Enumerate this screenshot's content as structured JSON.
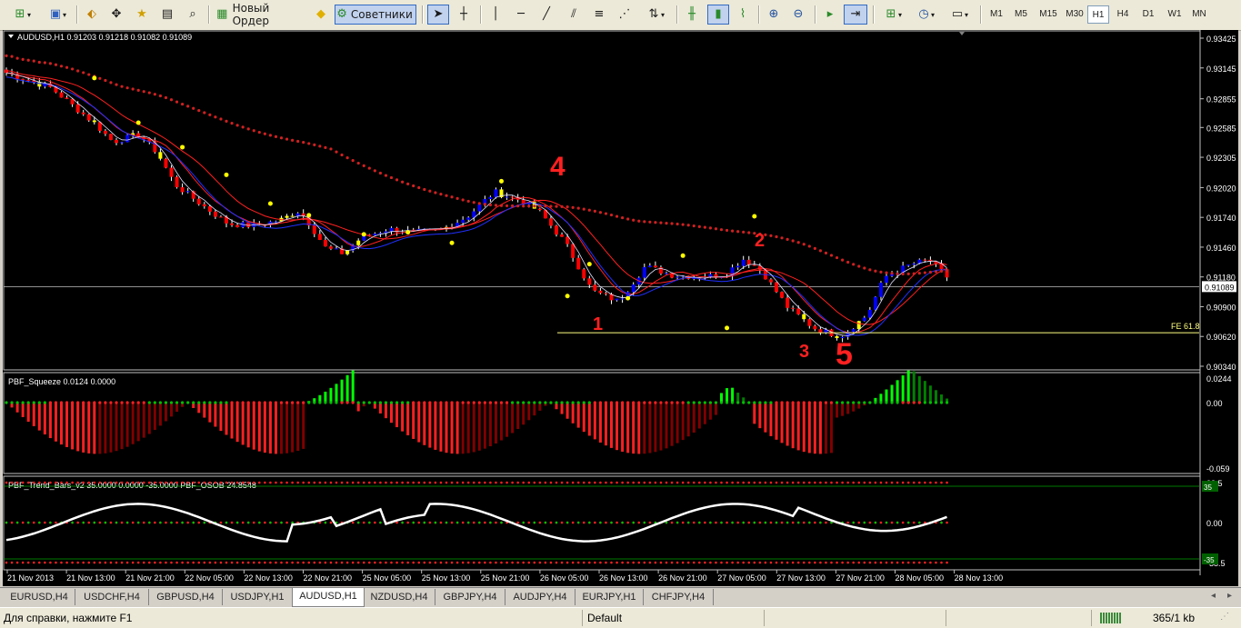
{
  "toolbar": {
    "new_order_label": "Новый Ордер",
    "advisors_label": "Советники",
    "timeframes": [
      "M1",
      "M5",
      "M15",
      "M30",
      "H1",
      "H4",
      "D1",
      "W1",
      "MN"
    ],
    "active_timeframe": "H1"
  },
  "chart": {
    "symbol_info": "AUDUSD,H1  0.91203 0.91218 0.91082 0.91089",
    "current_price": "0.91089",
    "fe_label": "FE 61.8",
    "price_ticks": [
      "0.93425",
      "0.93145",
      "0.92855",
      "0.92585",
      "0.92305",
      "0.92020",
      "0.91740",
      "0.91460",
      "0.91180",
      "0.90900",
      "0.90620",
      "0.90340"
    ],
    "annotations": [
      "4",
      "2",
      "1",
      "3",
      "5"
    ],
    "squeeze_label": "PBF_Squeeze 0.0124 0.0000",
    "squeeze_ticks": [
      "0.0244",
      "0.00",
      "-0.059"
    ],
    "trend_label": "PBF_Trend_Bars_v2 35.0000 0.0000 -35.0000  PBF_OSOB 24.8548",
    "trend_ticks": [
      "38.5",
      "0.00",
      "-38.5"
    ],
    "trend_level_high": "35",
    "trend_level_low": "-35",
    "time_labels": [
      "21 Nov 2013",
      "21 Nov 13:00",
      "21 Nov 21:00",
      "22 Nov 05:00",
      "22 Nov 13:00",
      "22 Nov 21:00",
      "25 Nov 05:00",
      "25 Nov 13:00",
      "25 Nov 21:00",
      "26 Nov 05:00",
      "26 Nov 13:00",
      "26 Nov 21:00",
      "27 Nov 05:00",
      "27 Nov 13:00",
      "27 Nov 21:00",
      "28 Nov 05:00",
      "28 Nov 13:00"
    ],
    "colors": {
      "bull": "#0000ff",
      "bear": "#ff0000",
      "doji": "#ffff00",
      "grid": "#c0c0c0",
      "green": "#00ff00"
    }
  },
  "tabs": [
    "EURUSD,H4",
    "USDCHF,H4",
    "GBPUSD,H4",
    "USDJPY,H1",
    "AUDUSD,H1",
    "NZDUSD,H4",
    "GBPJPY,H4",
    "AUDJPY,H4",
    "EURJPY,H1",
    "CHFJPY,H4"
  ],
  "active_tab": "AUDUSD,H1",
  "status": {
    "help": "Для справки, нажмите F1",
    "profile": "Default",
    "traffic": "365/1 kb"
  }
}
